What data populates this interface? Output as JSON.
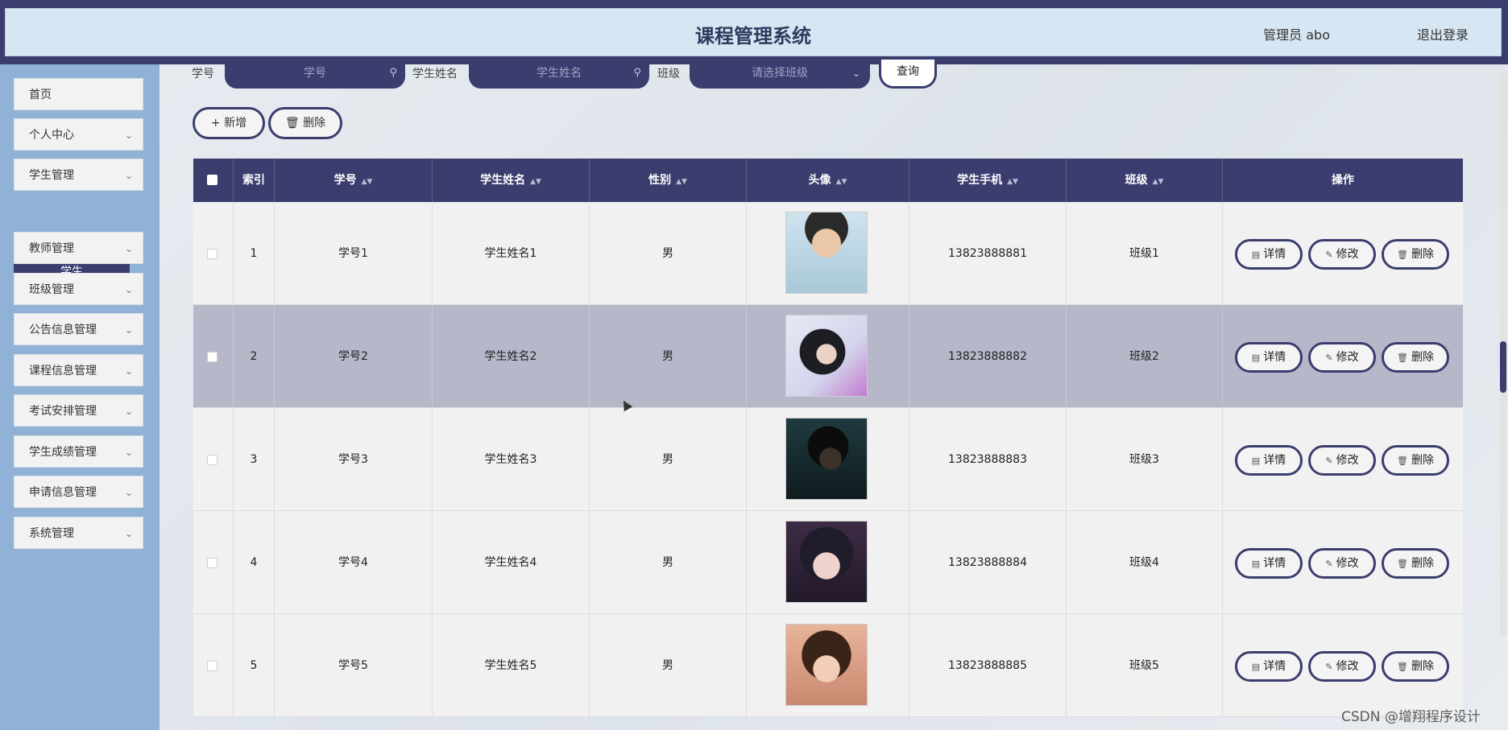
{
  "header": {
    "title": "课程管理系统",
    "user": "管理员 abo",
    "logout": "退出登录"
  },
  "sidebar": {
    "items": [
      {
        "label": "首页",
        "has_arrow": false
      },
      {
        "label": "个人中心",
        "has_arrow": true
      },
      {
        "label": "学生管理",
        "has_arrow": true
      },
      {
        "label": "教师管理",
        "has_arrow": true
      },
      {
        "label": "班级管理",
        "has_arrow": true
      },
      {
        "label": "公告信息管理",
        "has_arrow": true
      },
      {
        "label": "课程信息管理",
        "has_arrow": true
      },
      {
        "label": "考试安排管理",
        "has_arrow": true
      },
      {
        "label": "学生成绩管理",
        "has_arrow": true
      },
      {
        "label": "申请信息管理",
        "has_arrow": true
      },
      {
        "label": "系统管理",
        "has_arrow": true
      }
    ],
    "active_sub": "学生",
    "chevron": "chevron-down-icon"
  },
  "search": {
    "student_no_label": "学号",
    "student_no_placeholder": "学号",
    "name_label": "学生姓名",
    "name_placeholder": "学生姓名",
    "class_label": "班级",
    "class_placeholder": "请选择班级",
    "query_button": "查询"
  },
  "toolbar": {
    "add_label": "新增",
    "delete_label": "删除"
  },
  "table": {
    "columns": [
      "索引",
      "学号",
      "学生姓名",
      "性别",
      "头像",
      "学生手机",
      "班级",
      "操作"
    ],
    "rows": [
      {
        "index": "1",
        "no": "学号1",
        "name": "学生姓名1",
        "gender": "男",
        "phone": "13823888881",
        "class": "班级1"
      },
      {
        "index": "2",
        "no": "学号2",
        "name": "学生姓名2",
        "gender": "男",
        "phone": "13823888882",
        "class": "班级2"
      },
      {
        "index": "3",
        "no": "学号3",
        "name": "学生姓名3",
        "gender": "男",
        "phone": "13823888883",
        "class": "班级3"
      },
      {
        "index": "4",
        "no": "学号4",
        "name": "学生姓名4",
        "gender": "男",
        "phone": "13823888884",
        "class": "班级4"
      },
      {
        "index": "5",
        "no": "学号5",
        "name": "学生姓名5",
        "gender": "男",
        "phone": "13823888885",
        "class": "班级5"
      }
    ],
    "actions": {
      "detail": "详情",
      "edit": "修改",
      "delete": "删除"
    }
  },
  "watermark": "CSDN @增翔程序设计",
  "colors": {
    "primary": "#3a3d6e",
    "sidebar": "#8fb2d6",
    "header_bg": "#d6e6f2",
    "row_hover": "#b6b7c9"
  }
}
